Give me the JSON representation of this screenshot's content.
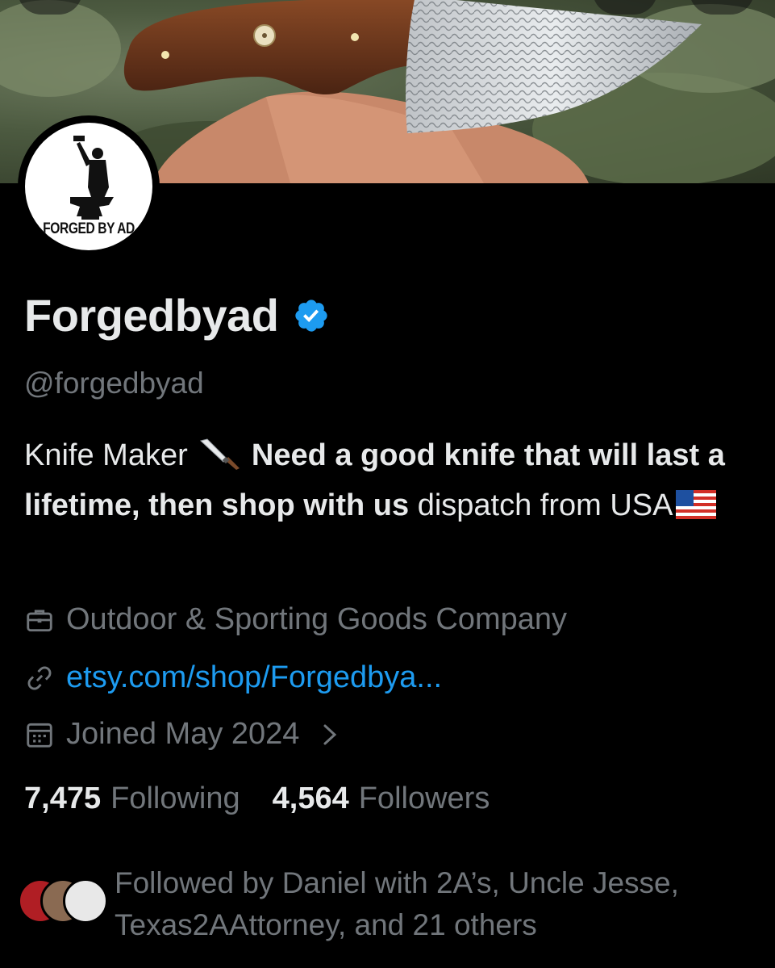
{
  "banner": {
    "image": "knife-banner-photo"
  },
  "avatar": {
    "logo_text": "FORGED BY AD"
  },
  "profile": {
    "display_name": "Forgedbyad",
    "handle": "@forgedbyad",
    "verified_icon": "verified-badge-icon"
  },
  "bio": {
    "part1": "Knife Maker ",
    "knife_emoji": "knife-emoji",
    "bold": "Need a good knife that will last a lifetime, then shop with us",
    "part2": " dispatch from USA",
    "flag_emoji": "us-flag-emoji"
  },
  "meta": {
    "category": "Outdoor & Sporting Goods Company",
    "link": "etsy.com/shop/Forgedbya...",
    "joined": "Joined May 2024"
  },
  "stats": {
    "following_count": "7,475",
    "following_label": "Following",
    "followers_count": "4,564",
    "followers_label": "Followers"
  },
  "followed_by": {
    "text": "Followed by Daniel with 2A’s, Uncle Jesse, Texas2AAttorney, and 21 others"
  },
  "colors": {
    "background": "#000000",
    "text_primary": "#e7e9ea",
    "text_secondary": "#71767b",
    "link": "#1d9bf0",
    "verified": "#1d9bf0"
  }
}
